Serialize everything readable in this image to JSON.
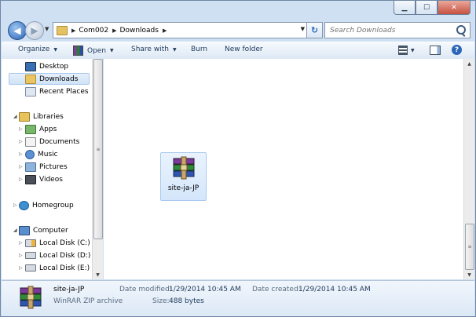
{
  "address": {
    "crumbs": [
      "Com002",
      "Downloads"
    ]
  },
  "search": {
    "placeholder": "Search Downloads"
  },
  "toolbar": {
    "organize": "Organize",
    "open": "Open",
    "share_with": "Share with",
    "burn": "Burn",
    "new_folder": "New folder"
  },
  "nav": {
    "favorites": [
      "Desktop",
      "Downloads",
      "Recent Places"
    ],
    "libraries": "Libraries",
    "library_items": [
      "Apps",
      "Documents",
      "Music",
      "Pictures",
      "Videos"
    ],
    "homegroup": "Homegroup",
    "computer": "Computer",
    "drives": [
      "Local Disk (C:)",
      "Local Disk (D:)",
      "Local Disk (E:)"
    ]
  },
  "files": [
    {
      "name": "site-ja-JP",
      "icon": "winrar-archive-icon",
      "selected": true
    }
  ],
  "details": {
    "name": "site-ja-JP",
    "type": "WinRAR ZIP archive",
    "modified_label": "Date modified:",
    "modified_value": "1/29/2014 10:45 AM",
    "created_label": "Date created:",
    "created_value": "1/29/2014 10:45 AM",
    "size_label": "Size:",
    "size_value": "488 bytes"
  },
  "colors": {
    "chrome": "#cfe0f3",
    "selection": "#cfe2f7",
    "close_button": "#c75040"
  }
}
